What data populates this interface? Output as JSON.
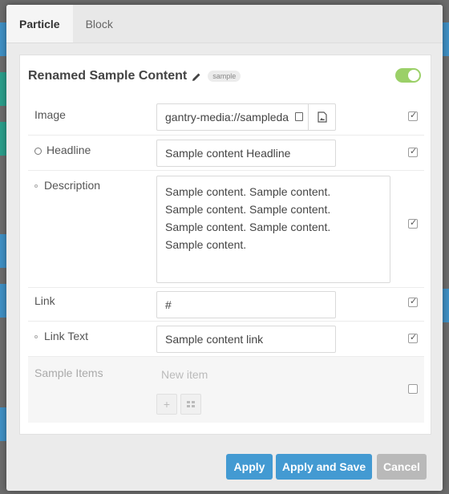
{
  "tabs": [
    {
      "label": "Particle",
      "active": true
    },
    {
      "label": "Block",
      "active": false
    }
  ],
  "card": {
    "title": "Renamed Sample Content",
    "badge": "sample",
    "enabled": true
  },
  "fields": {
    "image": {
      "label": "Image",
      "value": "gantry-media://sampleda",
      "checked": true
    },
    "headline": {
      "label": "Headline",
      "value": "Sample content Headline",
      "checked": true
    },
    "description": {
      "label": "Description",
      "value": "Sample content. Sample content.\nSample content. Sample content.\nSample content. Sample content.\nSample content.",
      "checked": true
    },
    "link": {
      "label": "Link",
      "value": "#",
      "checked": true
    },
    "link_text": {
      "label": "Link Text",
      "value": "Sample content link",
      "checked": true
    },
    "sample_items": {
      "label": "Sample Items",
      "placeholder": "New item",
      "checked": false
    }
  },
  "buttons": {
    "apply": "Apply",
    "apply_save": "Apply and Save",
    "cancel": "Cancel"
  },
  "colors": {
    "primary": "#439ad2",
    "cancel": "#b9b9b9",
    "toggle": "#9bd068"
  }
}
